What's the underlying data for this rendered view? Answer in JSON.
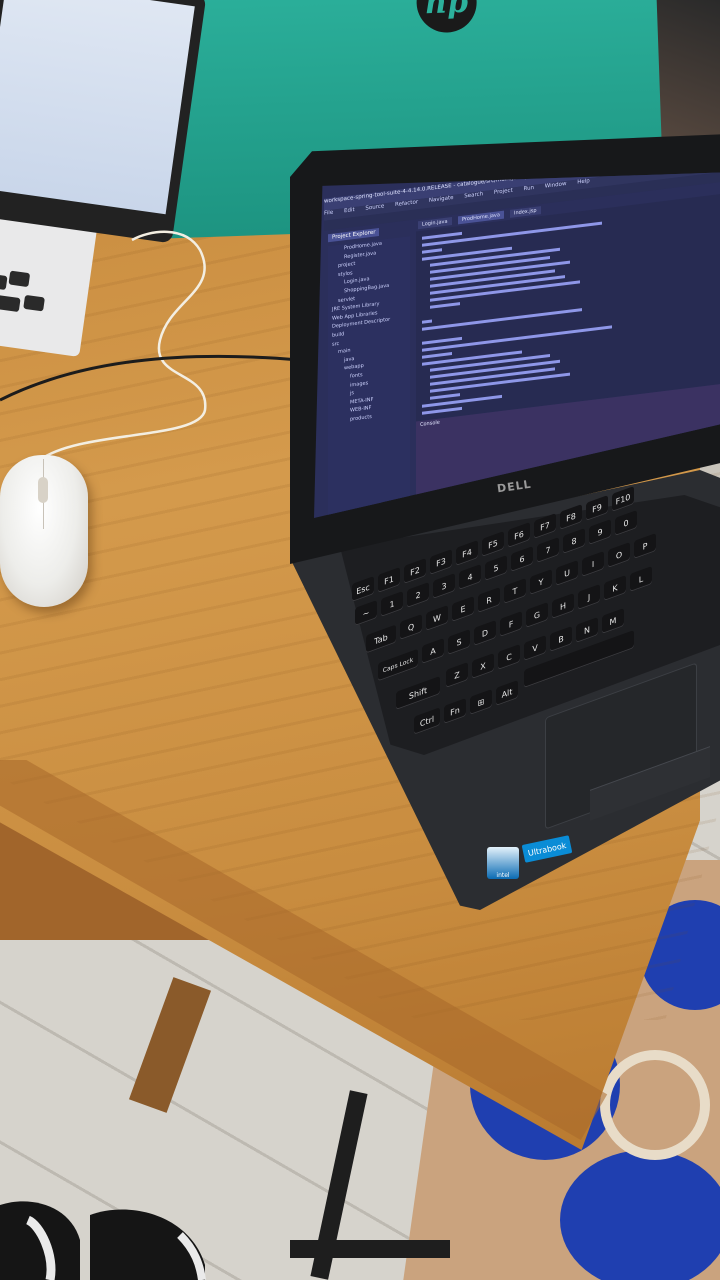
{
  "scene": {
    "description_free": true,
    "colors": {
      "table": "#c88b3e",
      "hp_lid": "#2cb19c",
      "dell_body": "#2b2d31",
      "screen_bg": "#2b2f5b",
      "rug_blue": "#1f3fb0"
    }
  },
  "hp_laptop": {
    "logo": "hp"
  },
  "dell_laptop": {
    "brand": "DELL",
    "stickers": {
      "intel": "intel",
      "ultrabook": "Ultrabook"
    },
    "ide": {
      "window_title": "workspace-spring-tool-suite-4-4.14.0.RELEASE - catalogue/src/main/java/produits/ProdHome.java - Spring Tool Suite 4",
      "menu": [
        "File",
        "Edit",
        "Source",
        "Refactor",
        "Navigate",
        "Search",
        "Project",
        "Run",
        "Window",
        "Help"
      ],
      "panel_tab": "Project Explorer",
      "editor_tabs": [
        "Login.java",
        "ProdHome.java",
        "Index.jsp"
      ],
      "tree_items": [
        "ProdHome.java",
        "Register.java",
        "project",
        "stylos",
        "Login.java",
        "ShoppingBag.java",
        "servlet",
        "JRE System Library",
        "Web App Libraries",
        "Deployment Descriptor",
        "build",
        "src",
        "main",
        "java",
        "webapp",
        "fonts",
        "images",
        "js",
        "META-INF",
        "WEB-INF",
        "products"
      ],
      "console_label": "Console"
    },
    "keys": {
      "row1": [
        "Esc",
        "F1",
        "F2",
        "F3",
        "F4",
        "F5",
        "F6",
        "F7",
        "F8",
        "F9",
        "F10"
      ],
      "row2": [
        "~",
        "1",
        "2",
        "3",
        "4",
        "5",
        "6",
        "7",
        "8",
        "9",
        "0"
      ],
      "row3": [
        "Tab",
        "Q",
        "W",
        "E",
        "R",
        "T",
        "Y",
        "U",
        "I",
        "O",
        "P"
      ],
      "row4": [
        "Caps Lock",
        "A",
        "S",
        "D",
        "F",
        "G",
        "H",
        "J",
        "K",
        "L"
      ],
      "row5": [
        "Shift",
        "Z",
        "X",
        "C",
        "V",
        "B",
        "N",
        "M"
      ],
      "row6": [
        "Ctrl",
        "Fn",
        "⊞",
        "Alt"
      ]
    }
  }
}
